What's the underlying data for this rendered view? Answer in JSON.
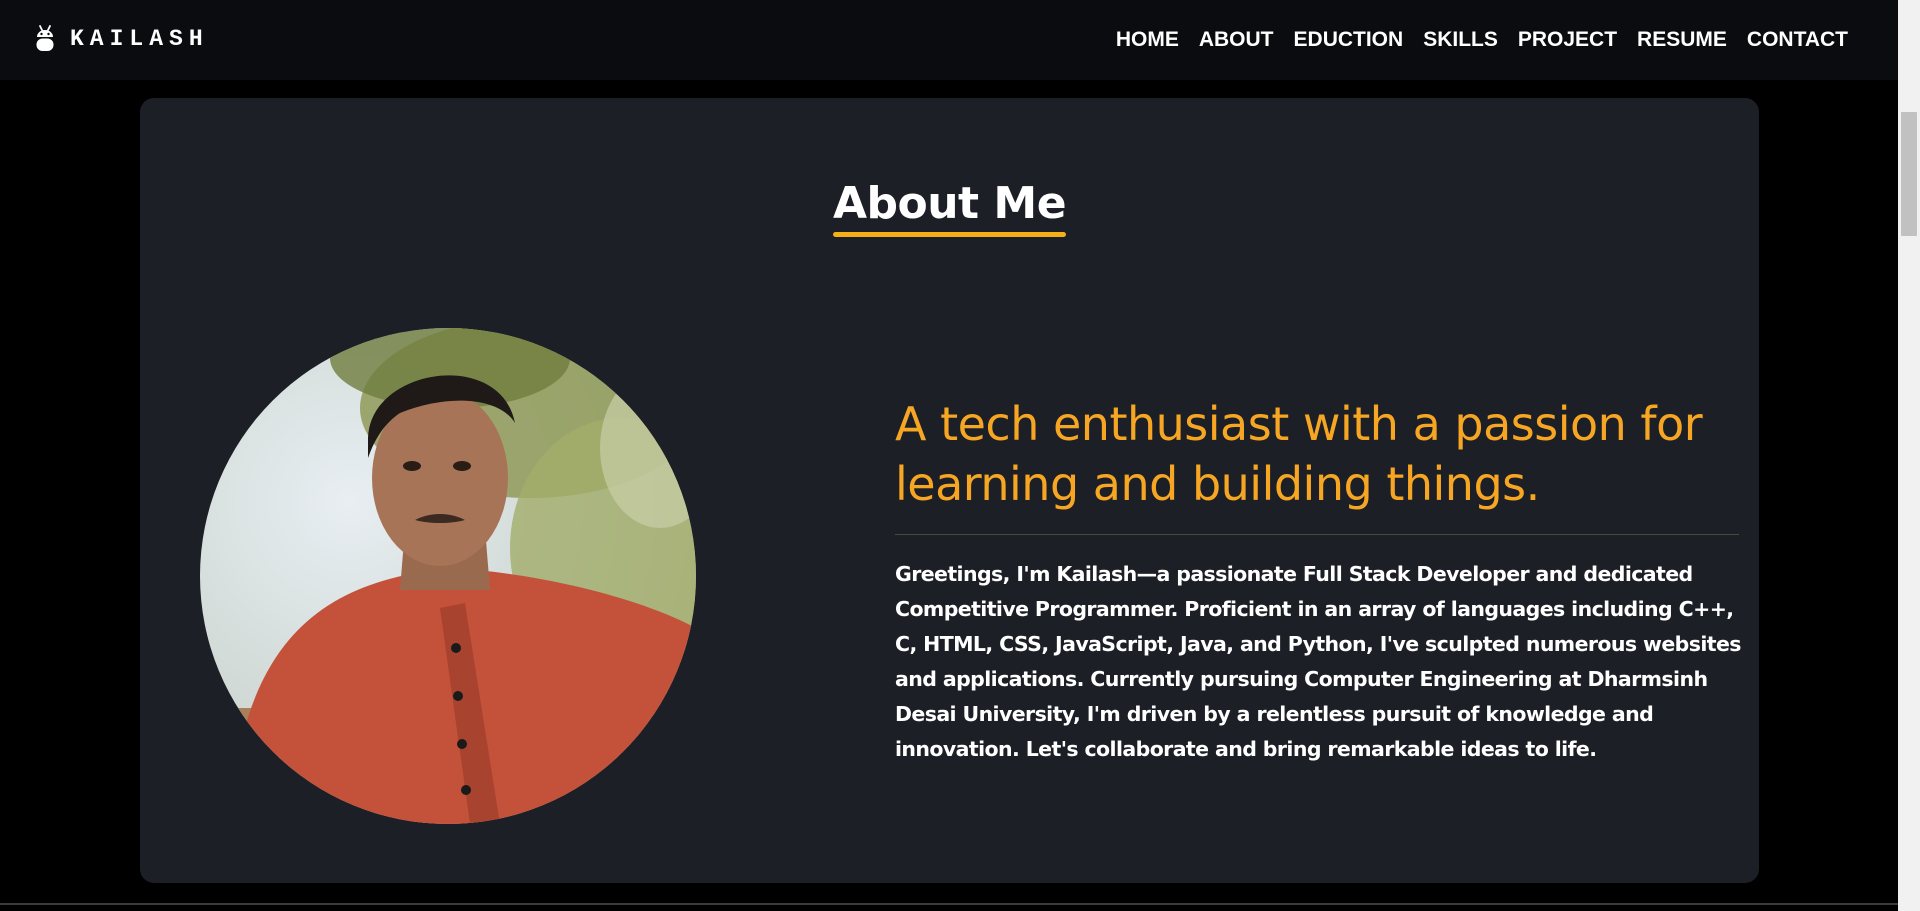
{
  "brand": {
    "name": "KAILASH",
    "icon": "android-robot-icon"
  },
  "nav": {
    "items": [
      {
        "label": "HOME"
      },
      {
        "label": "ABOUT"
      },
      {
        "label": "EDUCTION"
      },
      {
        "label": "SKILLS"
      },
      {
        "label": "PROJECT"
      },
      {
        "label": "RESUME"
      },
      {
        "label": "CONTACT"
      }
    ]
  },
  "about": {
    "title": "About Me",
    "tagline": "A tech enthusiast with a passion for learning and building things.",
    "bio": "Greetings, I'm Kailash—a passionate Full Stack Developer and dedicated Competitive Programmer. Proficient in an array of languages including C++, C, HTML, CSS, JavaScript, Java, and Python, I've sculpted numerous websites and applications. Currently pursuing Computer Engineering at Dharmsinh Desai University, I'm driven by a relentless pursuit of knowledge and innovation. Let's collaborate and bring remarkable ideas to life.",
    "photo_icon": "profile-photo"
  },
  "colors": {
    "accent": "#f6a623",
    "underline": "#f5b015",
    "card_bg": "#1c1f25",
    "nav_bg": "#0b0c10",
    "page_bg": "#000000"
  }
}
